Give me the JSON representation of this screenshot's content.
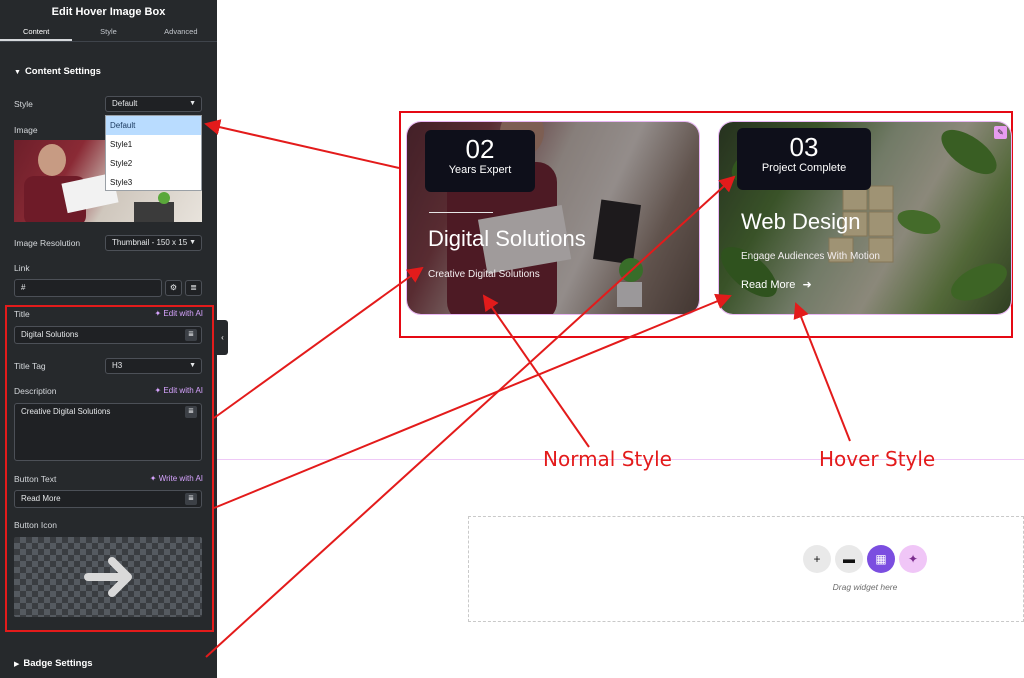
{
  "panel": {
    "title": "Edit Hover Image Box",
    "tabs": [
      "Content",
      "Style",
      "Advanced"
    ],
    "section_content": "Content Settings",
    "style_label": "Style",
    "style_value": "Default",
    "style_options": [
      "Default",
      "Style1",
      "Style2",
      "Style3"
    ],
    "image_label": "Image",
    "image_resolution_label": "Image Resolution",
    "image_resolution_value": "Thumbnail - 150 x 15",
    "link_label": "Link",
    "link_value": "#",
    "title_label": "Title",
    "edit_with_ai": "Edit with AI",
    "title_value": "Digital Solutions",
    "title_tag_label": "Title Tag",
    "title_tag_value": "H3",
    "description_label": "Description",
    "description_value": "Creative  Digital Solutions",
    "button_text_label": "Button Text",
    "write_with_ai": "Write with AI",
    "button_text_value": "Read More",
    "button_icon_label": "Button Icon",
    "badge_settings": "Badge Settings"
  },
  "cards": {
    "normal": {
      "badge_number": "02",
      "badge_text": "Years Expert",
      "title": "Digital Solutions",
      "description": "Creative Digital Solutions"
    },
    "hover": {
      "badge_number": "03",
      "badge_text": "Project Complete",
      "title": "Web Design",
      "description": "Engage Audiences With Motion",
      "button": "Read More"
    }
  },
  "captions": {
    "normal": "Normal Style",
    "hover": "Hover Style"
  },
  "drop_zone": {
    "text": "Drag widget here"
  },
  "colors": {
    "annotation_red": "#e31b1b",
    "panel_bg": "#26292c",
    "ai_purple": "#d7a4ff",
    "badge_bg": "#0e0f1a"
  }
}
